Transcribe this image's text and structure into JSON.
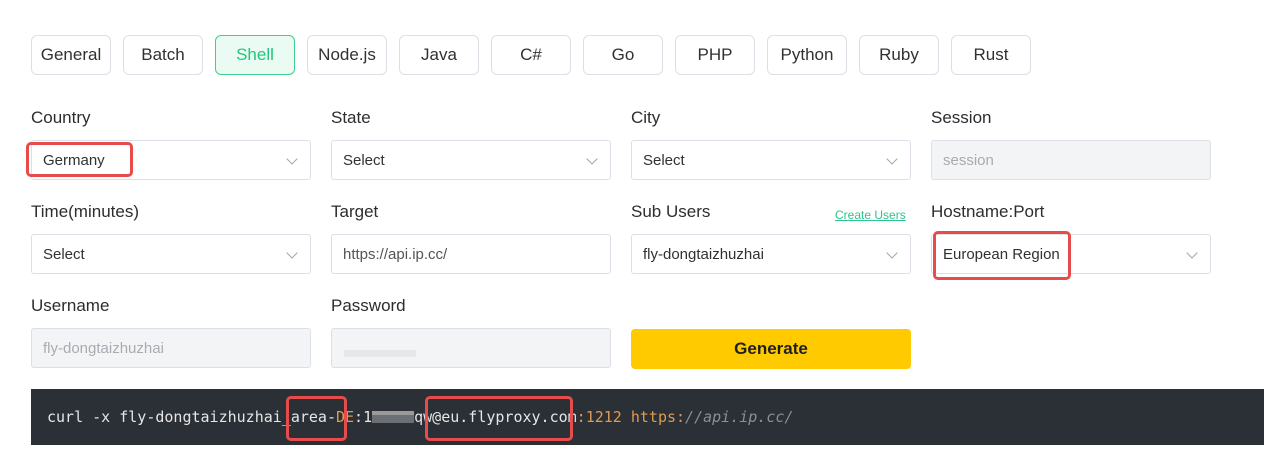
{
  "tabs": [
    {
      "label": "General"
    },
    {
      "label": "Batch"
    },
    {
      "label": "Shell",
      "active": true
    },
    {
      "label": "Node.js"
    },
    {
      "label": "Java"
    },
    {
      "label": "C#"
    },
    {
      "label": "Go"
    },
    {
      "label": "PHP"
    },
    {
      "label": "Python"
    },
    {
      "label": "Ruby"
    },
    {
      "label": "Rust"
    }
  ],
  "form": {
    "country": {
      "label": "Country",
      "value": "Germany"
    },
    "state": {
      "label": "State",
      "value": "Select"
    },
    "city": {
      "label": "City",
      "value": "Select"
    },
    "session": {
      "label": "Session",
      "placeholder": "session"
    },
    "time": {
      "label": "Time(minutes)",
      "value": "Select"
    },
    "target": {
      "label": "Target",
      "value": "https://api.ip.cc/"
    },
    "sub_users": {
      "label": "Sub Users",
      "link": "Create Users",
      "value": "fly-dongtaizhuzhai"
    },
    "hostname": {
      "label": "Hostname:Port",
      "value": "European Region"
    },
    "username": {
      "label": "Username",
      "value": "fly-dongtaizhuzhai"
    },
    "password": {
      "label": "Password"
    },
    "generate_label": "Generate"
  },
  "command": {
    "prefix": "curl -x fly-dongtaizhuzhai_area-",
    "area": "DE",
    "colon1": ":1",
    "tail": "qw@eu.flyproxy.com",
    "colon2": ":",
    "port": "1212",
    "space": " ",
    "scheme": "https:",
    "url_rest": "//api.ip.cc/"
  },
  "colors": {
    "accent": "#21c879",
    "button": "#ffca00",
    "highlight": "#e74c4c",
    "code_bg": "#2b2f36"
  }
}
